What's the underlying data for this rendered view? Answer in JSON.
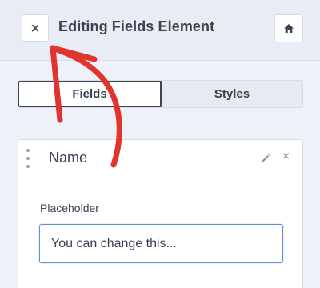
{
  "header": {
    "close_icon": "×",
    "title": "Editing Fields Element",
    "home_icon": "home-icon"
  },
  "tabs": [
    {
      "label": "Fields",
      "active": true
    },
    {
      "label": "Styles",
      "active": false
    }
  ],
  "field": {
    "name": "Name",
    "edit_icon": "pencil-icon",
    "remove_icon": "×",
    "placeholder_label": "Placeholder",
    "placeholder_value": "You can change this..."
  },
  "annotation": {
    "color": "#e0342f",
    "shape": "hand-drawn arrow pointing to close button"
  }
}
